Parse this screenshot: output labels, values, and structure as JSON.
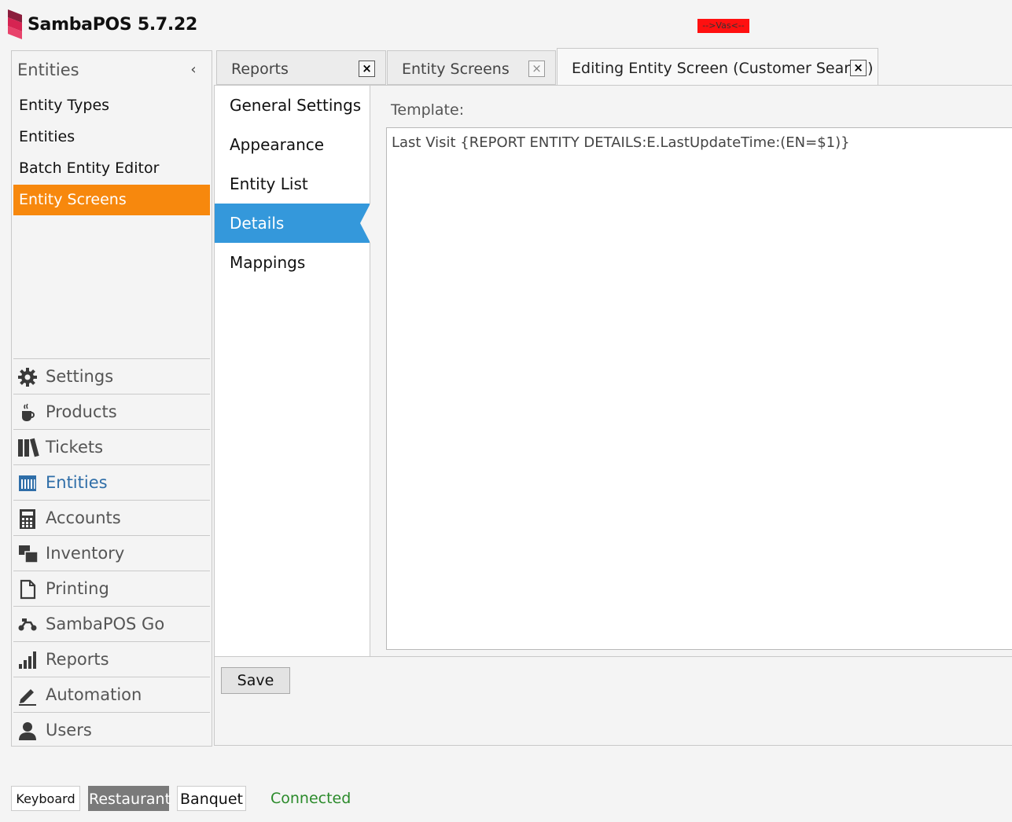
{
  "app": {
    "title": "SambaPOS 5.7.22",
    "tag": "-->Vas<--",
    "brand_color": "#d62452"
  },
  "left_panel": {
    "header": "Entities",
    "collapse_glyph": "‹",
    "sub_items": [
      {
        "label": "Entity Types"
      },
      {
        "label": "Entities"
      },
      {
        "label": "Batch Entity Editor"
      },
      {
        "label": "Entity Screens",
        "active": true
      }
    ],
    "nav": [
      {
        "label": "Settings",
        "icon": "gear-icon"
      },
      {
        "label": "Products",
        "icon": "coffee-cup-icon"
      },
      {
        "label": "Tickets",
        "icon": "books-icon"
      },
      {
        "label": "Entities",
        "icon": "calendar-grid-icon",
        "current": true
      },
      {
        "label": "Accounts",
        "icon": "calculator-icon"
      },
      {
        "label": "Inventory",
        "icon": "boxes-icon"
      },
      {
        "label": "Printing",
        "icon": "document-icon"
      },
      {
        "label": "SambaPOS Go",
        "icon": "scooter-icon"
      },
      {
        "label": "Reports",
        "icon": "bar-chart-icon"
      },
      {
        "label": "Automation",
        "icon": "pencil-icon"
      },
      {
        "label": "Users",
        "icon": "user-icon"
      }
    ]
  },
  "tabs": [
    {
      "label": "Reports",
      "close": "×"
    },
    {
      "label": "Entity Screens",
      "close": "×"
    },
    {
      "label": "Editing Entity Screen (Customer Search)",
      "close": "×",
      "active": true
    }
  ],
  "settings_menu": [
    {
      "label": "General Settings"
    },
    {
      "label": "Appearance"
    },
    {
      "label": "Entity List"
    },
    {
      "label": "Details",
      "active": true
    },
    {
      "label": "Mappings"
    }
  ],
  "details": {
    "template_label": "Template:",
    "template_value": "Last Visit {REPORT ENTITY DETAILS:E.LastUpdateTime:(EN=$1)}"
  },
  "footer": {
    "save_label": "Save"
  },
  "status_bar": {
    "keyboard": "Keyboard",
    "restaurant": "Restaurant",
    "banquet": "Banquet",
    "connection": "Connected",
    "selected": "Restaurant"
  },
  "colors": {
    "accent_orange": "#f7880d",
    "accent_blue": "#3498db",
    "connected_green": "#2a8a2a",
    "tag_red": "#ff1010"
  }
}
